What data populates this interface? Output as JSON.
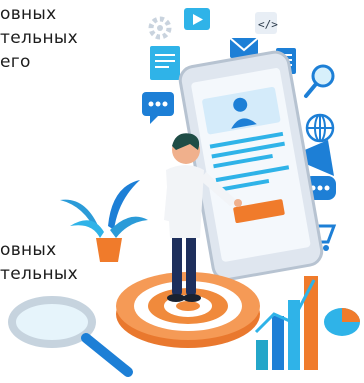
{
  "text_blocks": {
    "top": [
      "овных",
      "тельных",
      "его"
    ],
    "bottom": [
      "овных",
      "тельных"
    ]
  },
  "illustration": {
    "subject": "person-with-smartphone-profile-ui",
    "colors": {
      "phone_body": "#dfe6ef",
      "screen": "#f4f8fc",
      "accent_blue": "#1d7fd6",
      "accent_cyan": "#2fb3e8",
      "accent_orange": "#f07b2b",
      "target_orange": "#f08a3c",
      "plant_green": "#2b9bd8",
      "chart_teal": "#24a6c9"
    }
  }
}
